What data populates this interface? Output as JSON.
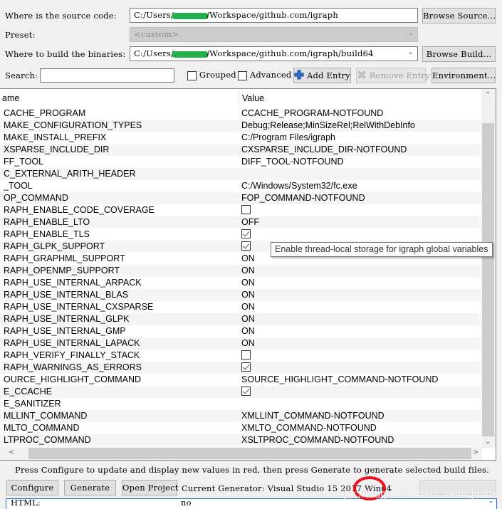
{
  "source": {
    "label": "Where is the source code:",
    "value_prefix": "C:/Users/",
    "value_suffix": "/Workspace/github.com/igraph",
    "browse_label": "Browse Source..."
  },
  "preset": {
    "label": "Preset:",
    "value": "<custom>"
  },
  "build": {
    "label": "Where to build the binaries:",
    "value_prefix": "C:/Users/",
    "value_suffix": "/Workspace/github.com/igraph/build64",
    "browse_label": "Browse Build..."
  },
  "search": {
    "label": "Search:",
    "value": "",
    "grouped_label": "Grouped",
    "grouped_checked": false,
    "advanced_label": "Advanced",
    "advanced_checked": false,
    "add_entry_label": "Add Entry",
    "remove_entry_label": "Remove Entry",
    "environment_label": "Environment..."
  },
  "table": {
    "columns": [
      "ame",
      "Value"
    ],
    "rows": [
      {
        "name": "CCACHE_PROGRAM",
        "value": "CCACHE_PROGRAM-NOTFOUND",
        "type": "text"
      },
      {
        "name": "CMAKE_CONFIGURATION_TYPES",
        "value": "Debug;Release;MinSizeRel;RelWithDebInfo",
        "type": "text"
      },
      {
        "name": "CMAKE_INSTALL_PREFIX",
        "value": "C:/Program Files/igraph",
        "type": "text"
      },
      {
        "name": "CXSPARSE_INCLUDE_DIR",
        "value": "CXSPARSE_INCLUDE_DIR-NOTFOUND",
        "type": "text"
      },
      {
        "name": "DIFF_TOOL",
        "value": "DIFF_TOOL-NOTFOUND",
        "type": "text"
      },
      {
        "name": "F_C_EXTERNAL_ARITH_HEADER",
        "value": "",
        "type": "text"
      },
      {
        "name": "FC_TOOL",
        "value": "C:/Windows/System32/fc.exe",
        "type": "text"
      },
      {
        "name": "FOP_COMMAND",
        "value": "FOP_COMMAND-NOTFOUND",
        "type": "text"
      },
      {
        "name": "IGRAPH_ENABLE_CODE_COVERAGE",
        "value": "",
        "type": "bool",
        "checked": false
      },
      {
        "name": "IGRAPH_ENABLE_LTO",
        "value": "OFF",
        "type": "text"
      },
      {
        "name": "IGRAPH_ENABLE_TLS",
        "value": "",
        "type": "bool",
        "checked": true
      },
      {
        "name": "IGRAPH_GLPK_SUPPORT",
        "value": "",
        "type": "bool",
        "checked": true
      },
      {
        "name": "IGRAPH_GRAPHML_SUPPORT",
        "value": "ON",
        "type": "text"
      },
      {
        "name": "IGRAPH_OPENMP_SUPPORT",
        "value": "ON",
        "type": "text"
      },
      {
        "name": "IGRAPH_USE_INTERNAL_ARPACK",
        "value": "ON",
        "type": "text"
      },
      {
        "name": "IGRAPH_USE_INTERNAL_BLAS",
        "value": "ON",
        "type": "text"
      },
      {
        "name": "IGRAPH_USE_INTERNAL_CXSPARSE",
        "value": "ON",
        "type": "text"
      },
      {
        "name": "IGRAPH_USE_INTERNAL_GLPK",
        "value": "ON",
        "type": "text"
      },
      {
        "name": "IGRAPH_USE_INTERNAL_GMP",
        "value": "ON",
        "type": "text"
      },
      {
        "name": "IGRAPH_USE_INTERNAL_LAPACK",
        "value": "ON",
        "type": "text"
      },
      {
        "name": "IGRAPH_VERIFY_FINALLY_STACK",
        "value": "",
        "type": "bool",
        "checked": false
      },
      {
        "name": "IGRAPH_WARNINGS_AS_ERRORS",
        "value": "",
        "type": "bool",
        "checked": true
      },
      {
        "name": "SOURCE_HIGHLIGHT_COMMAND",
        "value": "SOURCE_HIGHLIGHT_COMMAND-NOTFOUND",
        "type": "text"
      },
      {
        "name": "USE_CCACHE",
        "value": "",
        "type": "bool",
        "checked": true
      },
      {
        "name": "USE_SANITIZER",
        "value": "",
        "type": "text"
      },
      {
        "name": "XMLLINT_COMMAND",
        "value": "XMLLINT_COMMAND-NOTFOUND",
        "type": "text"
      },
      {
        "name": "XMLTO_COMMAND",
        "value": "XMLTO_COMMAND-NOTFOUND",
        "type": "text"
      },
      {
        "name": "XSLTPROC_COMMAND",
        "value": "XSLTPROC_COMMAND-NOTFOUND",
        "type": "text"
      }
    ],
    "row_labels_visible": [
      "CACHE_PROGRAM",
      "MAKE_CONFIGURATION_TYPES",
      "MAKE_INSTALL_PREFIX",
      "XSPARSE_INCLUDE_DIR",
      "FF_TOOL",
      "C_EXTERNAL_ARITH_HEADER",
      "_TOOL",
      "OP_COMMAND",
      "RAPH_ENABLE_CODE_COVERAGE",
      "RAPH_ENABLE_LTO",
      "RAPH_ENABLE_TLS",
      "RAPH_GLPK_SUPPORT",
      "RAPH_GRAPHML_SUPPORT",
      "RAPH_OPENMP_SUPPORT",
      "RAPH_USE_INTERNAL_ARPACK",
      "RAPH_USE_INTERNAL_BLAS",
      "RAPH_USE_INTERNAL_CXSPARSE",
      "RAPH_USE_INTERNAL_GLPK",
      "RAPH_USE_INTERNAL_GMP",
      "RAPH_USE_INTERNAL_LAPACK",
      "RAPH_VERIFY_FINALLY_STACK",
      "RAPH_WARNINGS_AS_ERRORS",
      "OURCE_HIGHLIGHT_COMMAND",
      "E_CCACHE",
      "E_SANITIZER",
      "MLLINT_COMMAND",
      "MLTO_COMMAND",
      "LTPROC_COMMAND"
    ]
  },
  "tooltip": "Enable thread-local storage for igraph global variables",
  "status_message": "Press Configure to update and display new values in red,  then press Generate to generate selected build files.",
  "actions": {
    "configure_label": "Configure",
    "generate_label": "Generate",
    "open_project_label": "Open Project",
    "generator_label": "Current Generator: Visual Studio 15 2017 Win64"
  },
  "output": {
    "key": "HTML:",
    "value": "no"
  },
  "watermark": "https://blog.csdn.net/cheungmine",
  "colors": {
    "redaction": "#22b14c",
    "annotation_circle": "#e8121b",
    "add_icon": "#1f5fbf"
  }
}
